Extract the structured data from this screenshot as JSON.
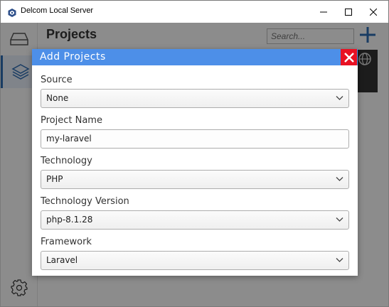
{
  "window": {
    "title": "Delcom Local Server"
  },
  "sidebar": {
    "items": [
      {
        "icon": "drive-icon"
      },
      {
        "icon": "layers-icon"
      },
      {
        "icon": "gear-icon"
      }
    ]
  },
  "main": {
    "title": "Projects",
    "search_placeholder": "Search..."
  },
  "dialog": {
    "title": "Add Projects",
    "fields": {
      "source": {
        "label": "Source",
        "value": "None"
      },
      "project_name": {
        "label": "Project Name",
        "value": "my-laravel"
      },
      "technology": {
        "label": "Technology",
        "value": "PHP"
      },
      "technology_version": {
        "label": "Technology Version",
        "value": "php-8.1.28"
      },
      "framework": {
        "label": "Framework",
        "value": "Laravel"
      }
    }
  },
  "colors": {
    "dialog_header": "#4d8fe8",
    "close_button": "#e81123",
    "accent": "#2f6db5"
  }
}
